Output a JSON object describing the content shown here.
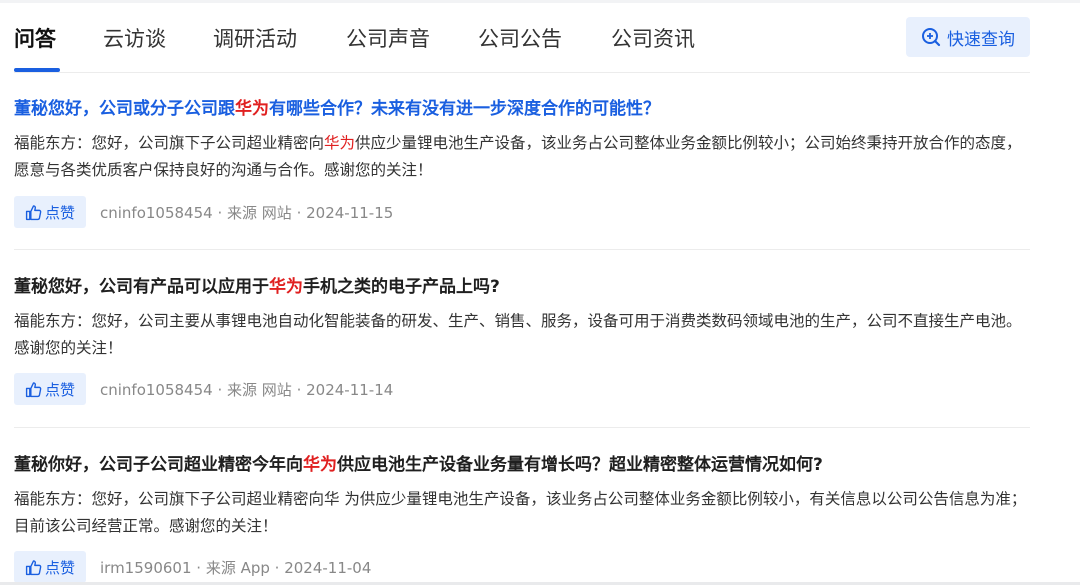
{
  "tabs": [
    {
      "label": "问答",
      "active": true
    },
    {
      "label": "云访谈"
    },
    {
      "label": "调研活动"
    },
    {
      "label": "公司声音"
    },
    {
      "label": "公司公告"
    },
    {
      "label": "公司资讯"
    }
  ],
  "quick_query": {
    "label": "快速查询",
    "icon": "search-plus-icon"
  },
  "items": [
    {
      "q_pre": "董秘您好，公司或分子公司跟",
      "q_hl": "华为",
      "q_post": "有哪些合作？未来有没有进一步深度合作的可能性？",
      "a_pre": "福能东方：您好，公司旗下子公司超业精密向",
      "a_hl": "华为",
      "a_post": "供应少量锂电池生产设备，该业务占公司整体业务金额比例较小；公司始终秉持开放合作的态度，愿意与各类优质客户保持良好的沟通与合作。感谢您的关注！",
      "like": "点赞",
      "user": "cninfo1058454",
      "source": "来源 网站",
      "date": "2024-11-15"
    },
    {
      "q_pre": "董秘您好，公司有产品可以应用于",
      "q_hl": "华为",
      "q_post": "手机之类的电子产品上吗?",
      "a_pre": "福能东方：您好，公司主要从事锂电池自动化智能装备的研发、生产、销售、服务，设备可用于消费类数码领域电池的生产，公司不直接生产电池。感谢您的关注！",
      "a_hl": "",
      "a_post": "",
      "like": "点赞",
      "user": "cninfo1058454",
      "source": "来源 网站",
      "date": "2024-11-14"
    },
    {
      "q_pre": "董秘你好，公司子公司超业精密今年向",
      "q_hl": "华为",
      "q_post": "供应电池生产设备业务量有增长吗？超业精密整体运营情况如何?",
      "a_pre": "福能东方：您好，公司旗下子公司超业精密向华 为供应少量锂电池生产设备，该业务占公司整体业务金额比例较小，有关信息以公司公告信息为准；目前该公司经营正常。感谢您的关注！",
      "a_hl": "",
      "a_post": "",
      "like": "点赞",
      "user": "irm1590601",
      "source": "来源 App",
      "date": "2024-11-04"
    }
  ],
  "colors": {
    "accent": "#1a5fe0",
    "highlight": "#e02020",
    "badge_bg": "#e8f0fd"
  }
}
